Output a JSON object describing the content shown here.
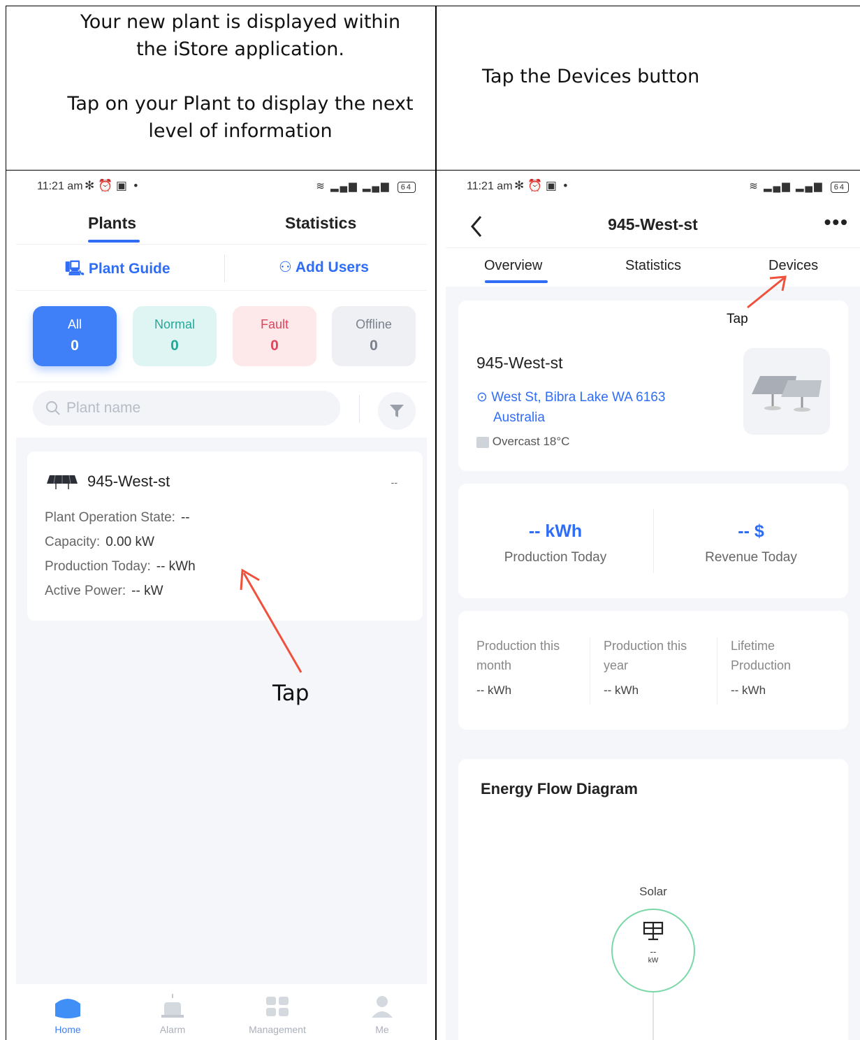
{
  "instructions": {
    "left": [
      "Your new plant is displayed within",
      "the iStore application.",
      "",
      "Tap on your Plant to display the next",
      "level of information"
    ],
    "right": "Tap the Devices button"
  },
  "status_bar": {
    "time": "11:21 am",
    "battery": "64"
  },
  "plants_screen": {
    "tabs": [
      "Plants",
      "Statistics"
    ],
    "active_tab": "Plants",
    "plant_guide": "Plant Guide",
    "add_users": "Add Users",
    "filters": [
      {
        "label": "All",
        "count": "0",
        "bg": "#3f7ff7",
        "fg": "#ffffff"
      },
      {
        "label": "Normal",
        "count": "0",
        "bg": "#dff5f3",
        "fg": "#23a89a"
      },
      {
        "label": "Fault",
        "count": "0",
        "bg": "#fde8ea",
        "fg": "#e2445c"
      },
      {
        "label": "Offline",
        "count": "0",
        "bg": "#eef0f3",
        "fg": "#7b818c"
      }
    ],
    "search_placeholder": "Plant name",
    "plant": {
      "name": "945-West-st",
      "status_value": "--",
      "props": [
        {
          "label": "Plant Operation State:",
          "value": "--"
        },
        {
          "label": "Capacity:",
          "value": "0.00 kW"
        },
        {
          "label": "Production Today:",
          "value": "-- kWh"
        },
        {
          "label": "Active Power:",
          "value": "-- kW"
        }
      ]
    },
    "tap_label": "Tap",
    "nav": [
      "Home",
      "Alarm",
      "Management",
      "Me"
    ],
    "active_nav": "Home"
  },
  "detail_screen": {
    "title": "945-West-st",
    "tabs": [
      "Overview",
      "Statistics",
      "Devices"
    ],
    "active_tab": "Overview",
    "tap_label": "Tap",
    "plant_name": "945-West-st",
    "address_line1": "West St, Bibra Lake WA 6163",
    "address_line2": "Australia",
    "weather": "Overcast 18°C",
    "production_today": {
      "value": "-- kWh",
      "label": "Production Today"
    },
    "revenue_today": {
      "value": "-- $",
      "label": "Revenue Today"
    },
    "stats": [
      {
        "label1": "Production this",
        "label2": "month",
        "value": "-- kWh"
      },
      {
        "label1": "Production this",
        "label2": "year",
        "value": "-- kWh"
      },
      {
        "label1": "Lifetime",
        "label2": "Production",
        "value": "-- kWh"
      }
    ],
    "energy_flow_title": "Energy Flow Diagram",
    "solar": {
      "label": "Solar",
      "value": "--",
      "unit": "kW"
    }
  },
  "colors": {
    "accent": "#2f6df6",
    "arrow": "#f0513c"
  }
}
